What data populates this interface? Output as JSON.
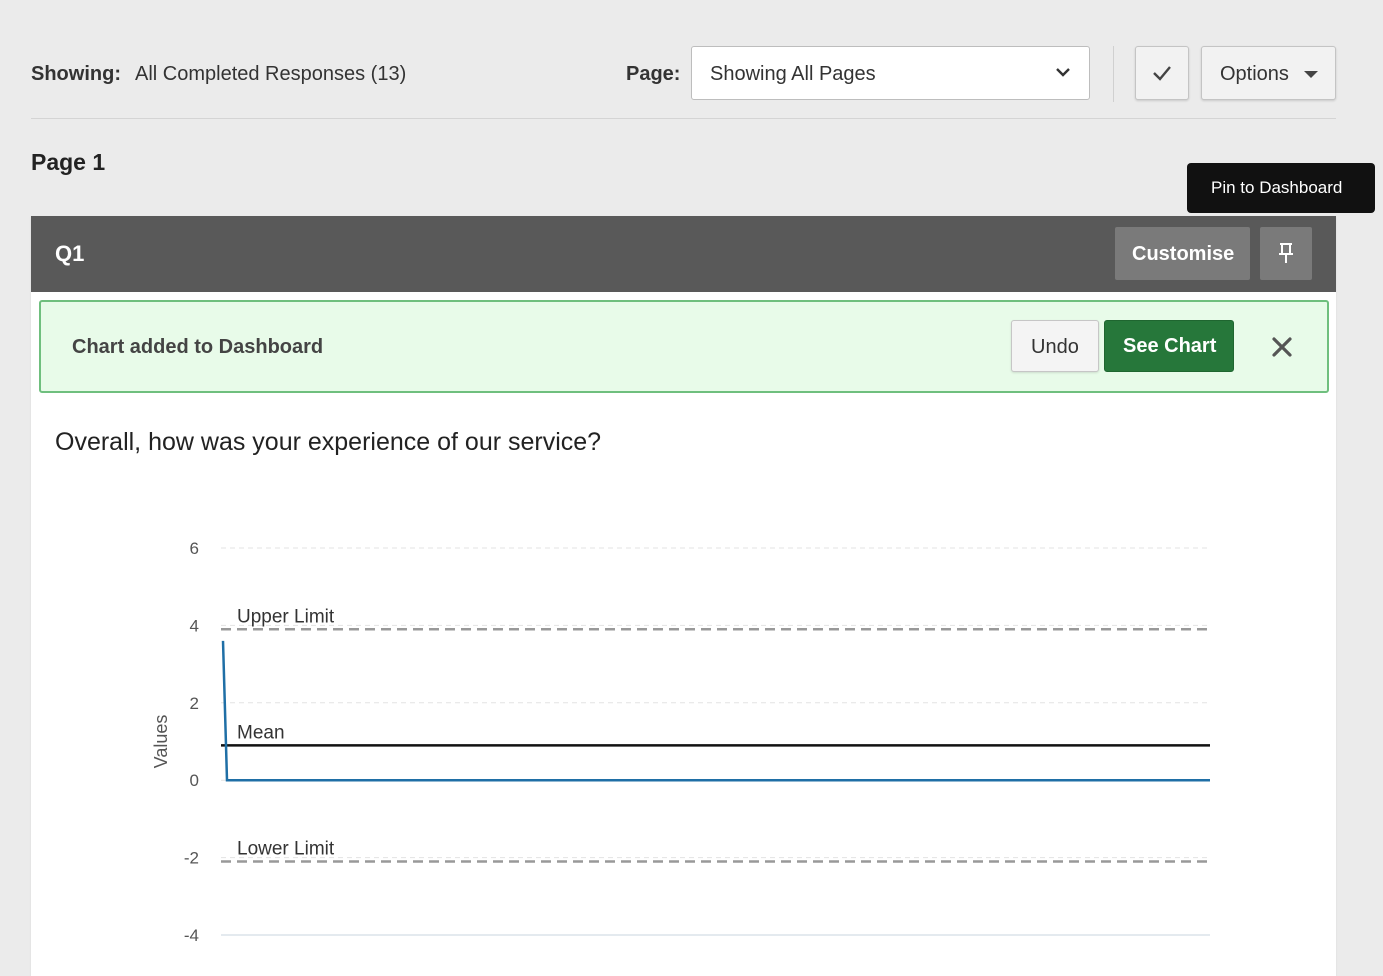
{
  "filter": {
    "showing_label": "Showing:",
    "showing_value": "All Completed Responses (13)",
    "page_label": "Page:",
    "page_select_value": "Showing All Pages",
    "options_label": "Options"
  },
  "page": {
    "title": "Page 1"
  },
  "tooltip": {
    "text": "Pin to Dashboard"
  },
  "question_card": {
    "id": "Q1",
    "customise_label": "Customise",
    "question": "Overall, how was your experience of our service?"
  },
  "alert": {
    "message": "Chart added to Dashboard",
    "undo_label": "Undo",
    "see_chart_label": "See Chart"
  },
  "icons": [
    "chevron-down-icon",
    "check-icon",
    "caret-down-icon",
    "pin-icon",
    "close-icon"
  ],
  "colors": {
    "header": "#595959",
    "success_bg": "#e8fbe9",
    "success_border": "#6fbf7e",
    "see_chart": "#26773a",
    "series": "#1f6fa6"
  },
  "chart_data": {
    "type": "line",
    "ylabel": "Values",
    "yticks": [
      6,
      4,
      2,
      0,
      -2,
      -4
    ],
    "ylim": [
      -4,
      6
    ],
    "series": [
      {
        "values": [
          3.6,
          0,
          0,
          0,
          0,
          0,
          0,
          0,
          0,
          0,
          0,
          0,
          0
        ]
      }
    ],
    "reference_lines": [
      {
        "label": "Upper Limit",
        "value": 3.9,
        "style": "dashed"
      },
      {
        "label": "Mean",
        "value": 0.9,
        "style": "solid"
      },
      {
        "label": "Lower Limit",
        "value": -2.1,
        "style": "dashed"
      }
    ],
    "grid": true
  }
}
